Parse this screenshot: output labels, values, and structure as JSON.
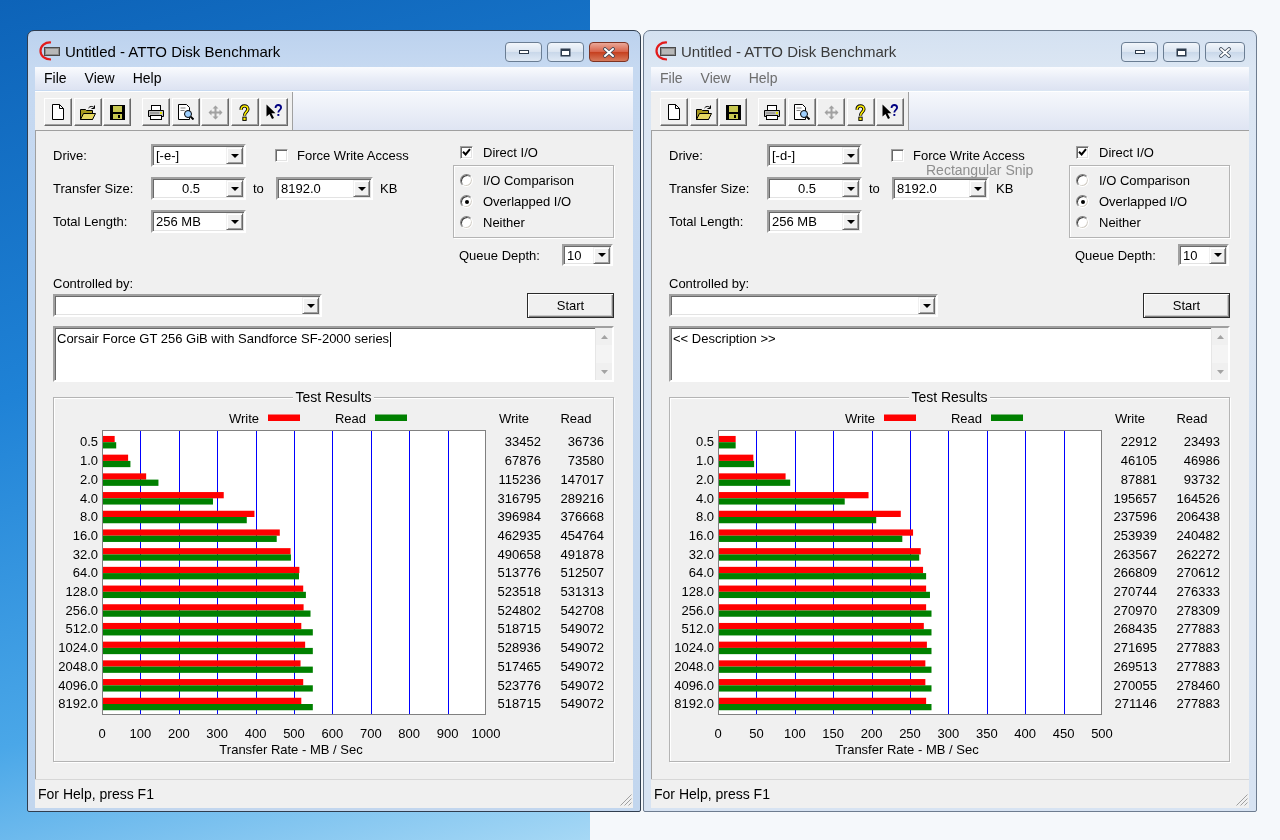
{
  "windows": [
    {
      "active": true,
      "title": "Untitled - ATTO Disk Benchmark",
      "menu": [
        "File",
        "View",
        "Help"
      ],
      "toolbar": [
        [
          {
            "kind": "new",
            "disabled": false
          },
          {
            "kind": "open",
            "disabled": false
          },
          {
            "kind": "save",
            "disabled": false
          }
        ],
        [
          {
            "kind": "print",
            "disabled": false
          },
          {
            "kind": "preview",
            "disabled": false
          },
          {
            "kind": "move",
            "disabled": true
          },
          {
            "kind": "help",
            "disabled": false
          },
          {
            "kind": "context_help",
            "disabled": false
          }
        ]
      ],
      "drive": {
        "label": "Drive:",
        "value": "[-e-]"
      },
      "force_write_access": {
        "label": "Force Write Access",
        "checked": false
      },
      "direct_io": {
        "label": "Direct I/O",
        "checked": true
      },
      "transfer_size": {
        "label": "Transfer Size:",
        "from": "0.5",
        "to_label": "to",
        "to": "8192.0",
        "unit": "KB"
      },
      "io_modes": [
        {
          "label": "I/O Comparison",
          "selected": false
        },
        {
          "label": "Overlapped I/O",
          "selected": true
        },
        {
          "label": "Neither",
          "selected": false
        }
      ],
      "total_length": {
        "label": "Total Length:",
        "value": "256 MB"
      },
      "queue_depth": {
        "label": "Queue Depth:",
        "value": "10"
      },
      "controlled_by": {
        "label": "Controlled by:"
      },
      "start_button": {
        "label": "Start"
      },
      "description": {
        "value": "Corsair Force GT 256 GiB with Sandforce SF-2000 series",
        "focused": true
      },
      "test_results": {
        "title": "Test Results",
        "chart_data": {
          "type": "bar",
          "orientation": "horizontal",
          "legend": "top",
          "grid": true,
          "xlabel": "Transfer Rate - MB / Sec",
          "xlim": [
            0,
            1000
          ],
          "xticks": [
            0,
            100,
            200,
            300,
            400,
            500,
            600,
            700,
            800,
            900,
            1000
          ],
          "categories": [
            "0.5",
            "1.0",
            "2.0",
            "4.0",
            "8.0",
            "16.0",
            "32.0",
            "64.0",
            "128.0",
            "256.0",
            "512.0",
            "1024.0",
            "2048.0",
            "4096.0",
            "8192.0"
          ],
          "series": [
            {
              "name": "Write",
              "color": "#ff0000",
              "values": [
                33,
                68,
                115,
                317,
                397,
                463,
                491,
                514,
                524,
                525,
                519,
                529,
                517,
                524,
                519
              ]
            },
            {
              "name": "Read",
              "color": "#008000",
              "values": [
                37,
                74,
                147,
                289,
                377,
                455,
                492,
                513,
                531,
                543,
                549,
                549,
                549,
                549,
                549
              ]
            }
          ]
        },
        "table": {
          "columns": [
            "Write",
            "Read"
          ],
          "rows": [
            [
              "33452",
              "36736"
            ],
            [
              "67876",
              "73580"
            ],
            [
              "115236",
              "147017"
            ],
            [
              "316795",
              "289216"
            ],
            [
              "396984",
              "376668"
            ],
            [
              "462935",
              "454764"
            ],
            [
              "490658",
              "491878"
            ],
            [
              "513776",
              "512507"
            ],
            [
              "523518",
              "531313"
            ],
            [
              "524802",
              "542708"
            ],
            [
              "518715",
              "549072"
            ],
            [
              "528936",
              "549072"
            ],
            [
              "517465",
              "549072"
            ],
            [
              "523776",
              "549072"
            ],
            [
              "518715",
              "549072"
            ]
          ]
        }
      },
      "status_bar": "For Help, press F1"
    },
    {
      "active": false,
      "title": "Untitled - ATTO Disk Benchmark",
      "menu": [
        "File",
        "View",
        "Help"
      ],
      "toolbar": [
        [
          {
            "kind": "new",
            "disabled": false
          },
          {
            "kind": "open",
            "disabled": false
          },
          {
            "kind": "save",
            "disabled": false
          }
        ],
        [
          {
            "kind": "print",
            "disabled": false
          },
          {
            "kind": "preview",
            "disabled": false
          },
          {
            "kind": "move",
            "disabled": true
          },
          {
            "kind": "help",
            "disabled": false
          },
          {
            "kind": "context_help",
            "disabled": false
          }
        ]
      ],
      "drive": {
        "label": "Drive:",
        "value": "[-d-]"
      },
      "force_write_access": {
        "label": "Force Write Access",
        "checked": false
      },
      "direct_io": {
        "label": "Direct I/O",
        "checked": true
      },
      "transfer_size": {
        "label": "Transfer Size:",
        "from": "0.5",
        "to_label": "to",
        "to": "8192.0",
        "unit": "KB"
      },
      "io_modes": [
        {
          "label": "I/O Comparison",
          "selected": false
        },
        {
          "label": "Overlapped I/O",
          "selected": true
        },
        {
          "label": "Neither",
          "selected": false
        }
      ],
      "total_length": {
        "label": "Total Length:",
        "value": "256 MB"
      },
      "queue_depth": {
        "label": "Queue Depth:",
        "value": "10"
      },
      "controlled_by": {
        "label": "Controlled by:"
      },
      "start_button": {
        "label": "Start"
      },
      "description": {
        "value": "<< Description >>",
        "focused": false
      },
      "tooltip": {
        "text": "Rectangular Snip"
      },
      "test_results": {
        "title": "Test Results",
        "chart_data": {
          "type": "bar",
          "orientation": "horizontal",
          "legend": "top",
          "grid": true,
          "xlabel": "Transfer Rate - MB / Sec",
          "xlim": [
            0,
            500
          ],
          "xticks": [
            0,
            50,
            100,
            150,
            200,
            250,
            300,
            350,
            400,
            450,
            500
          ],
          "categories": [
            "0.5",
            "1.0",
            "2.0",
            "4.0",
            "8.0",
            "16.0",
            "32.0",
            "64.0",
            "128.0",
            "256.0",
            "512.0",
            "1024.0",
            "2048.0",
            "4096.0",
            "8192.0"
          ],
          "series": [
            {
              "name": "Write",
              "color": "#ff0000",
              "values": [
                23,
                46,
                88,
                196,
                238,
                254,
                264,
                267,
                271,
                271,
                268,
                272,
                270,
                270,
                271
              ]
            },
            {
              "name": "Read",
              "color": "#008000",
              "values": [
                23,
                47,
                94,
                165,
                206,
                240,
                262,
                271,
                276,
                278,
                278,
                278,
                278,
                278,
                278
              ]
            }
          ]
        },
        "table": {
          "columns": [
            "Write",
            "Read"
          ],
          "rows": [
            [
              "22912",
              "23493"
            ],
            [
              "46105",
              "46986"
            ],
            [
              "87881",
              "93732"
            ],
            [
              "195657",
              "164526"
            ],
            [
              "237596",
              "206438"
            ],
            [
              "253939",
              "240482"
            ],
            [
              "263567",
              "262272"
            ],
            [
              "266809",
              "270612"
            ],
            [
              "270744",
              "276333"
            ],
            [
              "270970",
              "278309"
            ],
            [
              "268435",
              "277883"
            ],
            [
              "271695",
              "277883"
            ],
            [
              "269513",
              "277883"
            ],
            [
              "270055",
              "278460"
            ],
            [
              "271146",
              "277883"
            ]
          ]
        }
      },
      "status_bar": "For Help, press F1"
    }
  ]
}
